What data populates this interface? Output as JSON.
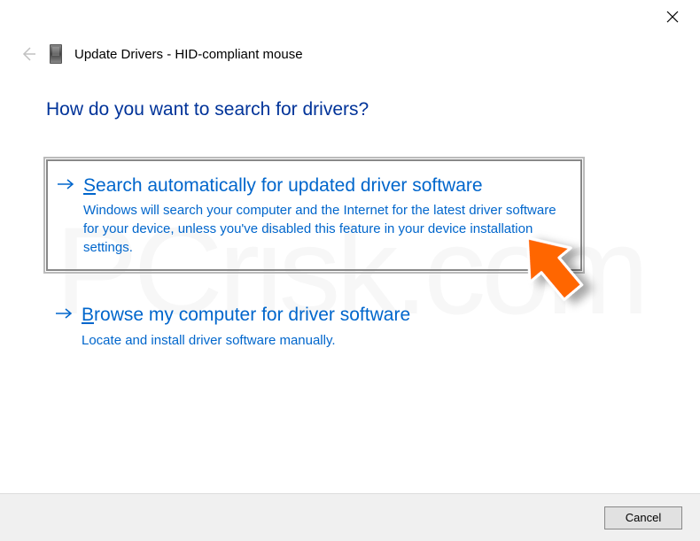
{
  "header": {
    "title": "Update Drivers - HID-compliant mouse"
  },
  "question": "How do you want to search for drivers?",
  "options": [
    {
      "title_mnemonic": "S",
      "title_rest": "earch automatically for updated driver software",
      "description": "Windows will search your computer and the Internet for the latest driver software for your device, unless you've disabled this feature in your device installation settings."
    },
    {
      "title_mnemonic": "B",
      "title_rest": "rowse my computer for driver software",
      "description": "Locate and install driver software manually."
    }
  ],
  "buttons": {
    "cancel": "Cancel"
  },
  "watermark": "PCrisk.com"
}
